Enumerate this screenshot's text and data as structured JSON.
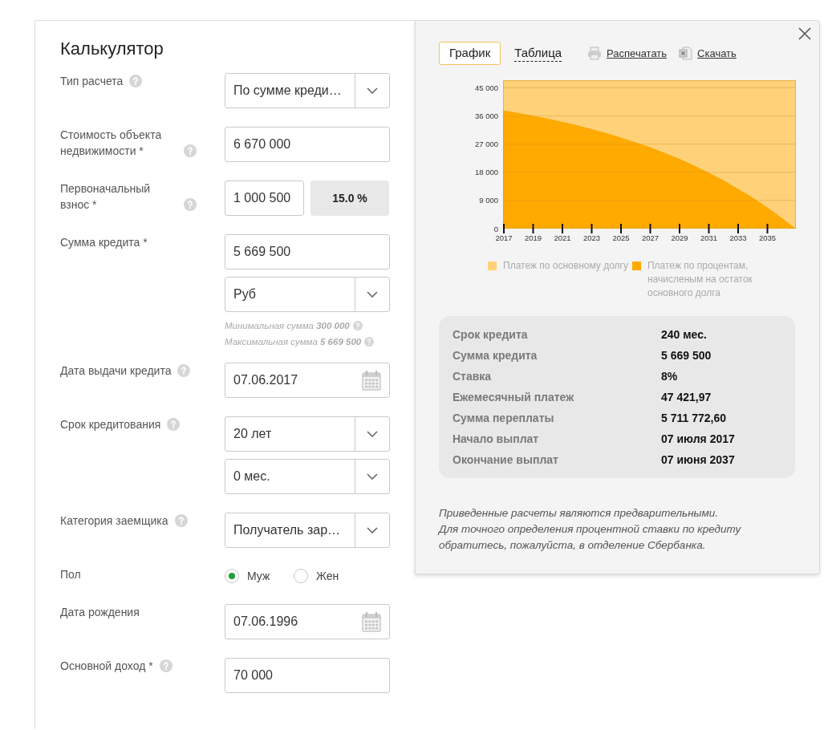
{
  "calculator": {
    "title": "Калькулятор",
    "rows": [
      {
        "label": "Тип расчета",
        "help": true,
        "controls": [
          {
            "kind": "select",
            "value": "По сумме креди…"
          }
        ]
      },
      {
        "label": "Стоимость объекта недвижимости *",
        "help": true,
        "controls": [
          {
            "kind": "input",
            "value": "6 670 000"
          }
        ]
      },
      {
        "label": "Первоначальный взнос *",
        "help": true,
        "controls": [
          {
            "kind": "amount",
            "value": "1 000 500",
            "share": "15.0 %"
          }
        ]
      },
      {
        "label": "Сумма кредита *",
        "help": false,
        "controls": [
          {
            "kind": "input",
            "value": "5 669 500"
          },
          {
            "kind": "select",
            "value": "Руб"
          },
          {
            "kind": "hint",
            "text": "Минимальная сумма **300 000**"
          },
          {
            "kind": "hint",
            "text": "Максимальная сумма **5 669 500**"
          }
        ]
      },
      {
        "label": "Дата выдачи кредита",
        "help": true,
        "controls": [
          {
            "kind": "date",
            "value": "07.06.2017"
          }
        ]
      },
      {
        "label": "Срок кредитования",
        "help": true,
        "controls": [
          {
            "kind": "select",
            "value": "20 лет"
          },
          {
            "kind": "select",
            "value": "0 мес."
          }
        ]
      },
      {
        "label": "Категория заемщика",
        "help": true,
        "controls": [
          {
            "kind": "select",
            "value": "Получатель зар…"
          }
        ]
      },
      {
        "label": "Пол",
        "help": false,
        "controls": [
          {
            "kind": "radio",
            "options": [
              {
                "label": "Муж",
                "selected": true
              },
              {
                "label": "Жен",
                "selected": false
              }
            ]
          }
        ]
      },
      {
        "label": "Дата рождения",
        "help": false,
        "controls": [
          {
            "kind": "date",
            "value": "07.06.1996"
          }
        ]
      },
      {
        "label": "Основной доход *",
        "help": true,
        "controls": [
          {
            "kind": "input",
            "value": "70 000"
          }
        ]
      }
    ]
  },
  "results": {
    "tabs": [
      {
        "label": "График",
        "selected": true
      },
      {
        "label": "Таблица",
        "selected": false
      }
    ],
    "actions": [
      {
        "label": "Распечатать",
        "kind": "print"
      },
      {
        "label": "Скачать",
        "kind": "download"
      }
    ],
    "chart_data": {
      "type": "area",
      "stacked": true,
      "x": [
        2017,
        2018,
        2019,
        2020,
        2021,
        2022,
        2023,
        2024,
        2025,
        2026,
        2027,
        2028,
        2029,
        2030,
        2031,
        2032,
        2033,
        2034,
        2035,
        2036,
        2037
      ],
      "series": [
        {
          "name": "Платеж по процентам, начисленым на остаток основного долга",
          "color": "#ffaa00",
          "values": [
            37800,
            37000,
            36100,
            35200,
            34200,
            33100,
            31900,
            30600,
            29200,
            27700,
            26100,
            24300,
            22400,
            20300,
            18000,
            15600,
            12900,
            10100,
            7000,
            3600,
            0
          ]
        },
        {
          "name": "Платеж по основному долгу",
          "color": "#ffd27a",
          "values": [
            9600,
            10400,
            11300,
            12200,
            13200,
            14300,
            15500,
            16800,
            18200,
            19700,
            21300,
            23100,
            25000,
            27100,
            29400,
            31800,
            34500,
            37300,
            40400,
            43800,
            47400
          ]
        }
      ],
      "grid": true,
      "xlim": [
        2017,
        2037
      ],
      "ylim": [
        0,
        47400
      ],
      "xticks": [
        2017,
        2019,
        2021,
        2023,
        2025,
        2027,
        2029,
        2031,
        2033,
        2035
      ],
      "yticks": [
        {
          "value": 0,
          "label": "0"
        },
        {
          "value": 9000,
          "label": "9 000"
        },
        {
          "value": 18000,
          "label": "18 000"
        },
        {
          "value": 27000,
          "label": "27 000"
        },
        {
          "value": 36000,
          "label": "36 000"
        },
        {
          "value": 45000,
          "label": "45 000"
        }
      ]
    },
    "summary": [
      {
        "label": "Срок кредита",
        "value": "240 мес."
      },
      {
        "label": "Сумма кредита",
        "value": "5 669 500"
      },
      {
        "label": "Ставка",
        "value": "8%"
      },
      {
        "label": "Ежемесячный платеж",
        "value": "47 421,97"
      },
      {
        "label": "Сумма переплаты",
        "value": "5 711 772,60"
      },
      {
        "label": "Начало выплат",
        "value": "07 июля 2017"
      },
      {
        "label": "Окончание выплат",
        "value": "07 июня 2037"
      }
    ],
    "note": "Приведенные расчеты являются предварительными.\nДля точного определения процентной ставки по кредиту\nобратитесь, пожалуйста, в отделение Сбербанка."
  }
}
